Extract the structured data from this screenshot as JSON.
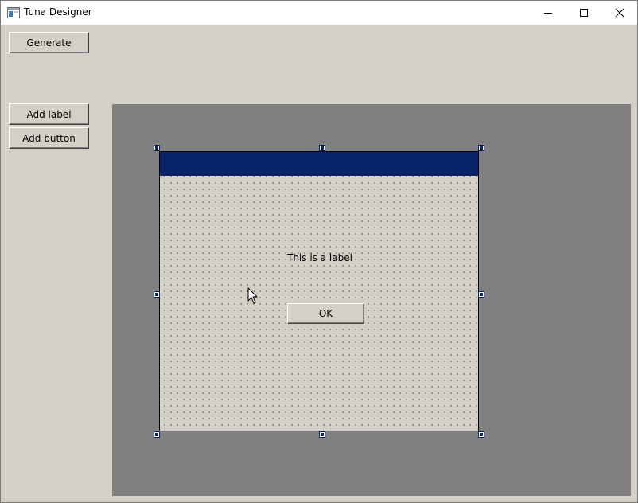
{
  "window": {
    "title": "Tuna Designer",
    "icons": [
      "app-window-icon",
      "minimize-icon",
      "maximize-icon",
      "close-icon"
    ]
  },
  "toolbar": {
    "generate_label": "Generate",
    "add_label_label": "Add label",
    "add_button_label": "Add button"
  },
  "designer": {
    "form_label_text": "This is a label",
    "form_button_label": "OK"
  },
  "colors": {
    "window_bg": "#d4d0c8",
    "canvas_bg": "#808080",
    "form_titlebar": "#0a246a",
    "selection_handle": "#0a246a"
  }
}
